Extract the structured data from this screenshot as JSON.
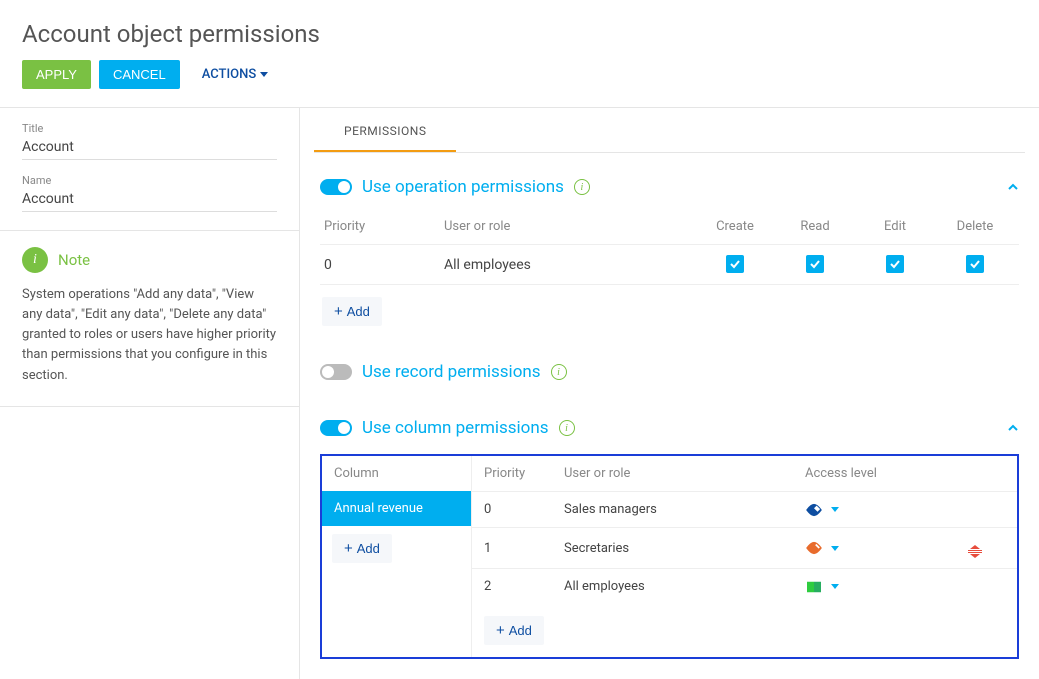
{
  "page_title": "Account object permissions",
  "toolbar": {
    "apply": "APPLY",
    "cancel": "CANCEL",
    "actions": "ACTIONS"
  },
  "details": {
    "title_label": "Title",
    "title_value": "Account",
    "name_label": "Name",
    "name_value": "Account"
  },
  "note": {
    "title": "Note",
    "body": "System operations \"Add any data\", \"View any data\", \"Edit any data\", \"Delete any data\" granted to roles or users have higher priority than permissions that you configure in this section."
  },
  "tabs": {
    "permissions": "PERMISSIONS"
  },
  "sections": {
    "operation": {
      "title": "Use operation permissions",
      "headers": {
        "priority": "Priority",
        "user_or_role": "User or role",
        "create": "Create",
        "read": "Read",
        "edit": "Edit",
        "delete": "Delete"
      },
      "rows": [
        {
          "priority": "0",
          "user_or_role": "All employees",
          "create": true,
          "read": true,
          "edit": true,
          "delete": true
        }
      ],
      "add": "Add"
    },
    "record": {
      "title": "Use record permissions"
    },
    "column": {
      "title": "Use column permissions",
      "column_header": "Column",
      "columns": [
        {
          "label": "Annual revenue",
          "selected": true
        }
      ],
      "add_column": "Add",
      "detail_headers": {
        "priority": "Priority",
        "user_or_role": "User or role",
        "access_level": "Access level"
      },
      "detail_rows": [
        {
          "priority": "0",
          "user_or_role": "Sales managers",
          "access": "edit",
          "access_color": "#0e4ea1"
        },
        {
          "priority": "1",
          "user_or_role": "Secretaries",
          "access": "read",
          "access_color": "#e86b2c"
        },
        {
          "priority": "2",
          "user_or_role": "All employees",
          "access": "deny",
          "access_color": "#2ecc40"
        }
      ],
      "add_row": "Add"
    }
  }
}
